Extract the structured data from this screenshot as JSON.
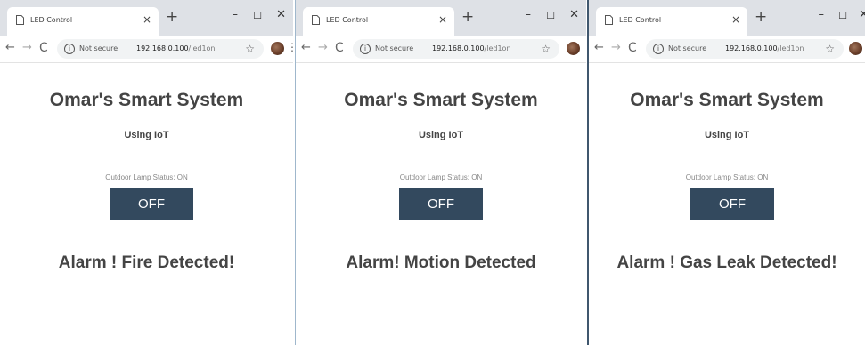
{
  "windows": [
    {
      "tab_title": "LED Control",
      "tab_close": "×",
      "new_tab": "+",
      "minimize": "–",
      "maximize": "☐",
      "close": "✕",
      "back": "←",
      "forward": "→",
      "reload": "C",
      "security_label": "Not secure",
      "url_host": "192.168.0.100",
      "url_path": "/led1on",
      "star": "☆",
      "menu": "⋮",
      "heading": "Omar's Smart System",
      "subheading": "Using IoT",
      "lamp_status": "Outdoor Lamp Status: ON",
      "button_label": "OFF",
      "alarm_text": "Alarm ! Fire Detected!"
    },
    {
      "tab_title": "LED Control",
      "tab_close": "×",
      "new_tab": "+",
      "minimize": "–",
      "maximize": "☐",
      "close": "✕",
      "back": "←",
      "forward": "→",
      "reload": "C",
      "security_label": "Not secure",
      "url_host": "192.168.0.100",
      "url_path": "/led1on",
      "star": "☆",
      "menu": "⋮",
      "heading": "Omar's Smart System",
      "subheading": "Using IoT",
      "lamp_status": "Outdoor Lamp Status: ON",
      "button_label": "OFF",
      "alarm_text": "Alarm! Motion Detected"
    },
    {
      "tab_title": "LED Control",
      "tab_close": "×",
      "new_tab": "+",
      "minimize": "–",
      "maximize": "☐",
      "close": "✕",
      "back": "←",
      "forward": "→",
      "reload": "C",
      "security_label": "Not secure",
      "url_host": "192.168.0.100",
      "url_path": "/led1on",
      "star": "☆",
      "heading": "Omar's Smart System",
      "subheading": "Using IoT",
      "lamp_status": "Outdoor Lamp Status: ON",
      "button_label": "OFF",
      "alarm_text": "Alarm ! Gas Leak Detected!"
    }
  ],
  "colors": {
    "tab_strip": "#dee1e6",
    "button_bg": "#33495e",
    "button_text": "#ffffff",
    "heading_text": "#444444",
    "status_text": "#888888"
  }
}
